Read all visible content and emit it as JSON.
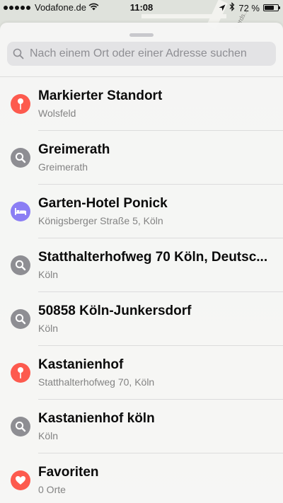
{
  "status_bar": {
    "carrier": "Vodafone.de",
    "time": "11:08",
    "battery_text": "72 %",
    "battery_level": 0.72
  },
  "map": {
    "street_label": "Kords..."
  },
  "search": {
    "placeholder": "Nach einem Ort oder einer Adresse suchen"
  },
  "results": [
    {
      "title": "Markierter Standort",
      "subtitle": "Wolsfeld",
      "icon": "pin-icon",
      "color": "#fd5a4e"
    },
    {
      "title": "Greimerath",
      "subtitle": "Greimerath",
      "icon": "search-icon",
      "color": "#8e8e93"
    },
    {
      "title": "Garten-Hotel Ponick",
      "subtitle": "Königsberger Straße 5, Köln",
      "icon": "bed-icon",
      "color": "#8b7ef4"
    },
    {
      "title": "Statthalterhofweg 70 Köln, Deutsc...",
      "subtitle": "Köln",
      "icon": "search-icon",
      "color": "#8e8e93"
    },
    {
      "title": "50858 Köln-Junkersdorf",
      "subtitle": "Köln",
      "icon": "search-icon",
      "color": "#8e8e93"
    },
    {
      "title": "Kastanienhof",
      "subtitle": "Statthalterhofweg 70, Köln",
      "icon": "pin-icon",
      "color": "#fd5a4e"
    },
    {
      "title": "Kastanienhof köln",
      "subtitle": "Köln",
      "icon": "search-icon",
      "color": "#8e8e93"
    },
    {
      "title": "Favoriten",
      "subtitle": "0 Orte",
      "icon": "heart-icon",
      "color": "#fd5a4e"
    }
  ]
}
